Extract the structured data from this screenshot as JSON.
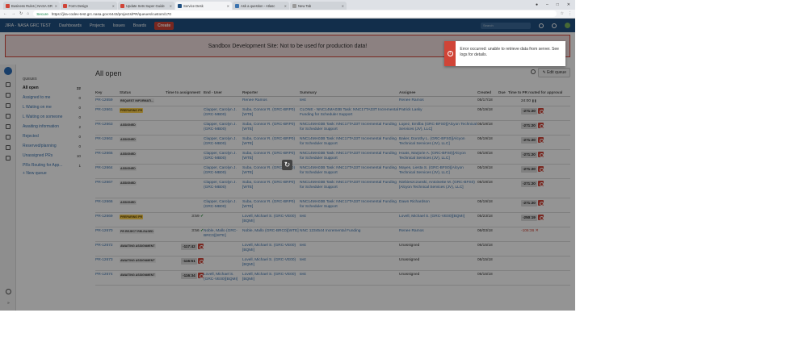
{
  "browser": {
    "tabs": [
      {
        "label": "Business Rules | NASA GR",
        "color": "#d04437"
      },
      {
        "label": "Form Design",
        "color": "#d04437"
      },
      {
        "label": "Update Sets Super Guide",
        "color": "#d04437"
      },
      {
        "label": "Service Desk",
        "color": "#205081",
        "active": true
      },
      {
        "label": "Ask a question - Atlasc",
        "color": "#3b73af"
      },
      {
        "label": "New Tab",
        "color": "#999"
      }
    ],
    "secure_label": "Secure",
    "url": "https://jira-codev-test.grc.nasa.gov:6443/projects/PR/queues/custom/170"
  },
  "nav": {
    "brand": "JIRA - NASA GRC TEST",
    "items": [
      "Dashboards",
      "Projects",
      "Issues",
      "Boards"
    ],
    "create_label": "Create",
    "search_placeholder": "Search",
    "avatar_initials": "FB"
  },
  "banner": {
    "text": "Sandbox Development Site: Not to be used for production data!"
  },
  "error": {
    "text": "Error occurred: unable to retrieve data from server. See logs for details."
  },
  "queues": {
    "heading": "QUEUES",
    "items": [
      {
        "label": "All open",
        "count": "22",
        "active": true
      },
      {
        "label": "Assigned to me",
        "count": "0"
      },
      {
        "label": "L Waiting on me",
        "count": "0"
      },
      {
        "label": "L Waiting on someone",
        "count": "0"
      },
      {
        "label": "Awaiting information",
        "count": "2"
      },
      {
        "label": "Rejected",
        "count": "0"
      },
      {
        "label": "Reserved/planning",
        "count": "0"
      },
      {
        "label": "Unassigned PRs",
        "count": "10"
      },
      {
        "label": "PRs Routing for App...",
        "count": "1"
      }
    ],
    "new_queue_label": "New queue"
  },
  "main": {
    "title": "All open",
    "edit_label": "Edit queue",
    "columns": [
      "Key",
      "Status",
      "Time to assignment",
      "End - User",
      "Reporter",
      "Summary",
      "Assignee",
      "Created",
      "Due",
      "Time to PR routed for approval"
    ]
  },
  "rows": [
    {
      "key": "PR-12659",
      "status": "REQUEST INFORMATI...",
      "status_yel": false,
      "tta": "",
      "end_user": "",
      "reporter": "Renee Ramos",
      "summary": "test",
      "assignee": "Renee Ramos",
      "created": "05/17/18",
      "due": "",
      "ttr": "24:00",
      "ttr_icon": "pause"
    },
    {
      "key": "PR-12661",
      "status": "PREPARING PR",
      "status_yel": true,
      "tta": "",
      "end_user": "Clapper, Carolyn J. (GRC-MB00)",
      "reporter": "Suba, Connor R. (GRC-BRP0)[WTE]",
      "summary": "CLONE - NNC14MA03B Task: NNC17TA33T Incremental Funding for Scheduler Support",
      "assignee": "Patrick Lasky",
      "created": "05/19/18",
      "due": "",
      "ttr": "-271:20",
      "ttr_icon": "stop"
    },
    {
      "key": "PR-12663",
      "status": "ASSIGNED",
      "status_yel": false,
      "tta": "",
      "end_user": "Clapper, Carolyn J. (GRC-MB00)",
      "reporter": "Suba, Connor R. (GRC-BRP0)[WTE]",
      "summary": "NNC14MA03B Task: NNC17TA33T Incremental Funding for Scheduler Support",
      "assignee": "Lopez, Emilba (GRC-BFS0)[Alcyon Technical Services (JV), LLC]",
      "created": "05/19/18",
      "due": "",
      "ttr": "-271:20",
      "ttr_icon": "stop"
    },
    {
      "key": "PR-12662",
      "status": "ASSIGNED",
      "status_yel": false,
      "tta": "",
      "end_user": "Clapper, Carolyn J. (GRC-MB00)",
      "reporter": "Suba, Connor R. (GRC-BRP0)[WTE]",
      "summary": "NNC14MA03B Task: NNC17TA33T Incremental Funding for Scheduler Support",
      "assignee": "Baker, Dorothy L. (GRC-BFS0)[Alcyon Technical Services (JV), LLC]",
      "created": "05/19/18",
      "due": "",
      "ttr": "-271:20",
      "ttr_icon": "stop"
    },
    {
      "key": "PR-12665",
      "status": "ASSIGNED",
      "status_yel": false,
      "tta": "",
      "end_user": "Clapper, Carolyn J. (GRC-MB00)",
      "reporter": "Suba, Connor R. (GRC-BRP0)[WTE]",
      "summary": "NNC14MA03B Task: NNC17TA33T Incremental Funding for Scheduler Support",
      "assignee": "Hoats, Marjorie A. (GRC-BFS0)[Alcyon Technical Services (JV), LLC]",
      "created": "05/19/18",
      "due": "",
      "ttr": "-271:20",
      "ttr_icon": "stop"
    },
    {
      "key": "PR-12664",
      "status": "ASSIGNED",
      "status_yel": false,
      "tta": "",
      "end_user": "Clapper, Carolyn J. (GRC-MB00)",
      "reporter": "Suba, Connor R. (GRC-BRP0)[WTE]",
      "summary": "NNC14MA03B Task: NNC17TA33T Incremental Funding for Scheduler Support",
      "assignee": "Mayes, Liesta S. (GRC-BFS0)[Alcyon Technical Services (JV), LLC]",
      "created": "05/19/18",
      "due": "",
      "ttr": "-271:20",
      "ttr_icon": "stop"
    },
    {
      "key": "PR-12667",
      "status": "ASSIGNED",
      "status_yel": false,
      "tta": "",
      "end_user": "Clapper, Carolyn J. (GRC-MB00)",
      "reporter": "Suba, Connor R. (GRC-BRP0)[WTE]",
      "summary": "NNC14MA03B Task: NNC17TA33T Incremental Funding for Scheduler Support",
      "assignee": "Niebieszczanski, Antoinette M. (GRC-BFS0)[Alcyon Technical Services (JV), LLC]",
      "created": "05/19/18",
      "due": "",
      "ttr": "-271:20",
      "ttr_icon": "stop"
    },
    {
      "key": "PR-12666",
      "status": "ASSIGNED",
      "status_yel": false,
      "tta": "",
      "end_user": "Clapper, Carolyn J. (GRC-MB00)",
      "reporter": "Suba, Connor R. (GRC-BRP0)[WTE]",
      "summary": "NNC14MA03B Task: NNC17TA33T Incremental Funding for Scheduler Support",
      "assignee": "Dawn Richardson",
      "created": "05/19/18",
      "due": "",
      "ttr": "-271:20",
      "ttr_icon": "stop"
    },
    {
      "key": "PR-12669",
      "status": "PREPARING PR",
      "status_yel": true,
      "tta": "3:59",
      "tta_icon": "check",
      "end_user": "",
      "reporter": "Lovell, Michael S. (GRC-VE00)[BQMI]",
      "summary": "test",
      "assignee": "Lovell, Michael S. (GRC-VE00)[BQMI]",
      "created": "05/23/18",
      "due": "",
      "ttr": "-250:19",
      "ttr_icon": "stop"
    },
    {
      "key": "PR-12670",
      "status": "PR REJECT RELEASED",
      "status_yel": false,
      "tta": "3:56",
      "tta_icon": "check",
      "end_user": "Noble, Mallo (GRC-BRC0)[WTE]",
      "reporter": "Noble, Mallo (GRC-BRC0)[WTE]",
      "summary": "NNC 1234544 Incremental Funding",
      "assignee": "Renee Ramos",
      "created": "06/03/18",
      "due": "",
      "ttr": "-106:36",
      "ttr_icon": "x"
    },
    {
      "key": "PR-12672",
      "status": "AWAITING ASSIGNMENT",
      "status_yel": false,
      "tta": "-117:42",
      "tta_icon": "stop",
      "end_user": "",
      "reporter": "Lovell, Michael S. (GRC-VE00)[BQMI]",
      "summary": "test",
      "assignee": "Unassigned",
      "created": "06/15/18",
      "due": "",
      "ttr": "",
      "ttr_icon": ""
    },
    {
      "key": "PR-12673",
      "status": "AWAITING ASSIGNMENT",
      "status_yel": false,
      "tta": "-116:51",
      "tta_icon": "stop",
      "end_user": "",
      "reporter": "Lovell, Michael S. (GRC-VE00)[BQMI]",
      "summary": "test",
      "assignee": "Unassigned",
      "created": "06/15/18",
      "due": "",
      "ttr": "",
      "ttr_icon": ""
    },
    {
      "key": "PR-12674",
      "status": "AWAITING ASSIGNMENT",
      "status_yel": false,
      "tta": "-116:34",
      "tta_icon": "stop",
      "end_user": "Lovell, Michael S. (GRC-VE00)[BQMI]",
      "reporter": "Lovell, Michael S. (GRC-VE00)[BQMI]",
      "summary": "test",
      "assignee": "Unassigned",
      "created": "06/15/18",
      "due": "",
      "ttr": "",
      "ttr_icon": ""
    }
  ]
}
